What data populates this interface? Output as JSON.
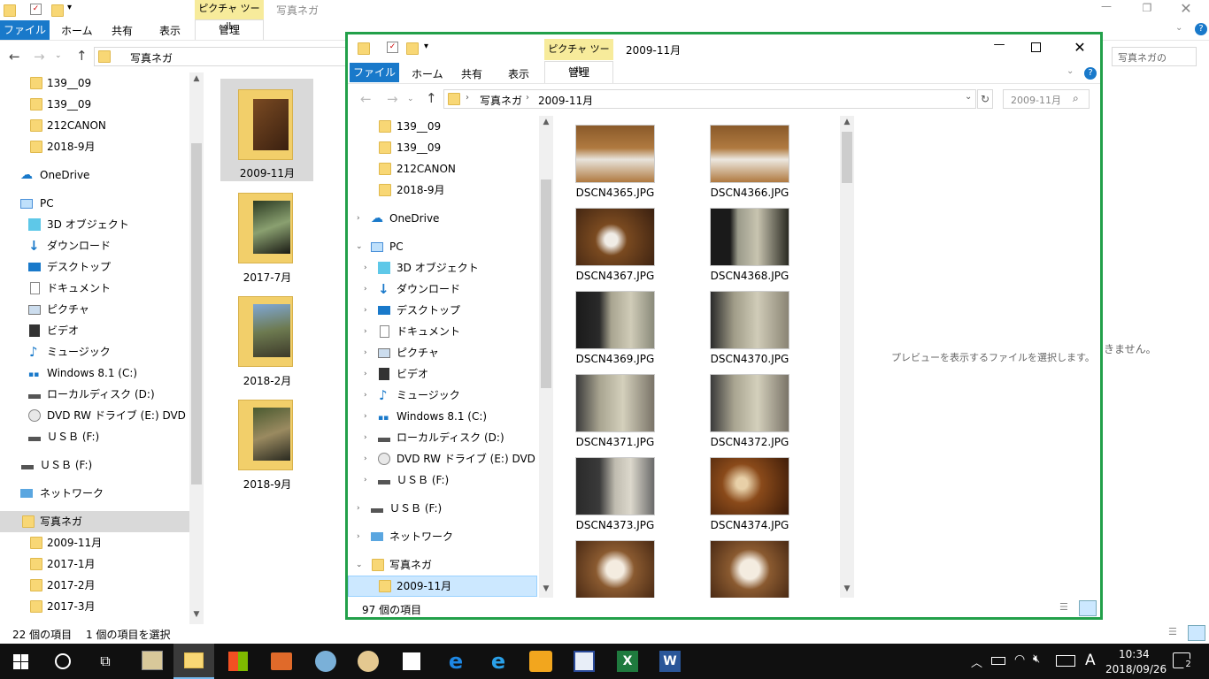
{
  "back_window": {
    "title": "写真ネガ",
    "tool_group": "ピクチャ ツール",
    "tabs": [
      "ファイル",
      "ホーム",
      "共有",
      "表示"
    ],
    "manage_tab": "管理",
    "address": "写真ネガ",
    "search_placeholder": "写真ネガの",
    "tree": [
      "139__09",
      "139__09",
      "212CANON",
      "2018-9月",
      "OneDrive",
      "PC",
      "3D オブジェクト",
      "ダウンロード",
      "デスクトップ",
      "ドキュメント",
      "ピクチャ",
      "ビデオ",
      "ミュージック",
      "Windows 8.1 (C:)",
      "ローカルディスク (D:)",
      "DVD RW ドライブ (E:) DVD",
      "ＵＳＢ (F:)",
      "ＵＳＢ (F:)",
      "ネットワーク",
      "写真ネガ",
      "2009-11月",
      "2017-1月",
      "2017-2月",
      "2017-3月"
    ],
    "folders": [
      "2009-11月",
      "2017-7月",
      "2018-2月",
      "2018-9月"
    ],
    "preview_partial": "きません。",
    "status_count": "22 個の項目",
    "status_selected": "1 個の項目を選択"
  },
  "front_window": {
    "title": "2009-11月",
    "tool_group": "ピクチャ ツール",
    "tabs": [
      "ファイル",
      "ホーム",
      "共有",
      "表示"
    ],
    "manage_tab": "管理",
    "breadcrumb": [
      "写真ネガ",
      "2009-11月"
    ],
    "search_placeholder": "2009-11月",
    "tree": [
      "139__09",
      "139__09",
      "212CANON",
      "2018-9月",
      "OneDrive",
      "PC",
      "3D オブジェクト",
      "ダウンロード",
      "デスクトップ",
      "ドキュメント",
      "ピクチャ",
      "ビデオ",
      "ミュージック",
      "Windows 8.1 (C:)",
      "ローカルディスク (D:)",
      "DVD RW ドライブ (E:) DVD",
      "ＵＳＢ (F:)",
      "ＵＳＢ (F:)",
      "ネットワーク",
      "写真ネガ",
      "2009-11月"
    ],
    "files": [
      "DSCN4365.JPG",
      "DSCN4366.JPG",
      "DSCN4367.JPG",
      "DSCN4368.JPG",
      "DSCN4369.JPG",
      "DSCN4370.JPG",
      "DSCN4371.JPG",
      "DSCN4372.JPG",
      "DSCN4373.JPG",
      "DSCN4374.JPG",
      "",
      ""
    ],
    "preview_message": "プレビューを表示するファイルを選択します。",
    "status_count": "97 個の項目"
  },
  "taskbar": {
    "ime": "A",
    "time": "10:34",
    "date": "2018/09/26",
    "notifications": "2"
  },
  "colors": {
    "accent": "#1979ca",
    "highlight_border": "#22a04a",
    "selected": "#cce8ff",
    "tool_tab": "#f7eb9b"
  }
}
